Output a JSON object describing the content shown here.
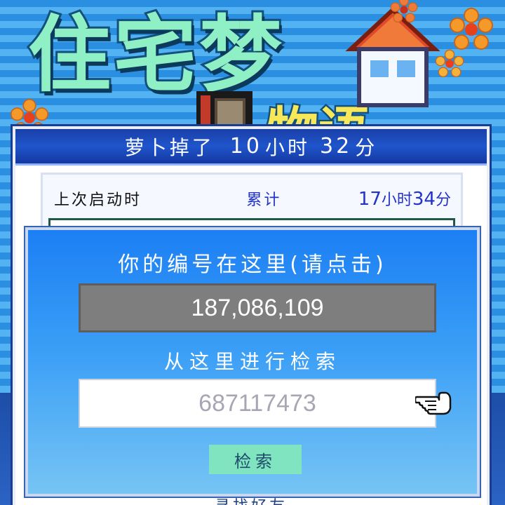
{
  "game_logo": {
    "title": "住宅梦",
    "subtitle": "物语"
  },
  "summary": {
    "label": "萝卜掉了",
    "hours": "10",
    "hours_unit": "小时",
    "minutes": "32",
    "minutes_unit": "分"
  },
  "stats": {
    "last_start_label": "上次启动时",
    "total_label": "累计",
    "hours": "17",
    "hours_unit": "小时",
    "minutes": "34",
    "minutes_unit": "分"
  },
  "bottom_hint": "寻找好友",
  "dialog": {
    "title": "你的编号在这里(请点击)",
    "player_id": "187,086,109",
    "search_label": "从这里进行检索",
    "search_value": "687117473",
    "search_button": "检索"
  },
  "colors": {
    "header_blue": "#1f55cc",
    "dialog_blue": "#1c7ff4",
    "id_box_gray": "#7e7e7e",
    "button_mint": "#7fe4bf"
  },
  "icons": [
    "flower-icon",
    "house-icon",
    "pointing-hand-icon"
  ]
}
